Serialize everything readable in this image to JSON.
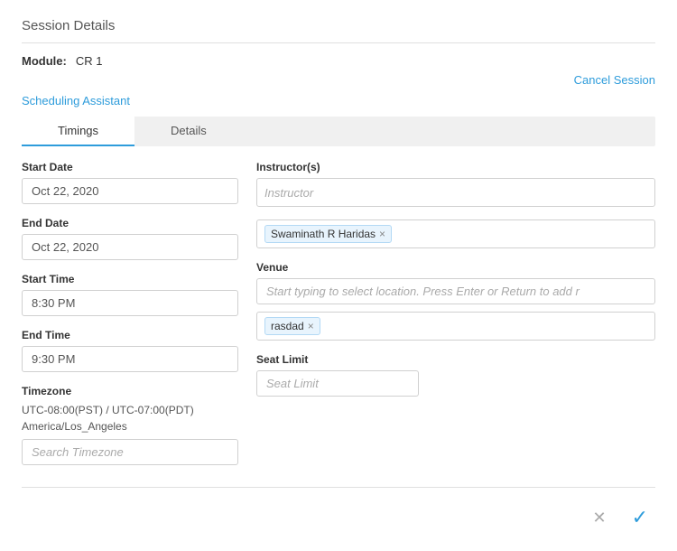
{
  "page": {
    "title": "Session Details",
    "module_label": "Module:",
    "module_value": "CR 1",
    "cancel_session": "Cancel Session",
    "scheduling_assistant": "Scheduling Assistant"
  },
  "tabs": [
    {
      "label": "Timings",
      "active": true
    },
    {
      "label": "Details",
      "active": false
    }
  ],
  "left_col": {
    "start_date_label": "Start Date",
    "start_date_value": "Oct 22, 2020",
    "end_date_label": "End Date",
    "end_date_value": "Oct 22, 2020",
    "start_time_label": "Start Time",
    "start_time_value": "8:30 PM",
    "end_time_label": "End Time",
    "end_time_value": "9:30 PM",
    "timezone_label": "Timezone",
    "timezone_text": "UTC-08:00(PST) / UTC-07:00(PDT) America/Los_Angeles",
    "timezone_placeholder": "Search Timezone"
  },
  "right_col": {
    "instructors_label": "Instructor(s)",
    "instructor_placeholder": "Instructor",
    "instructor_tag": "Swaminath R Haridas",
    "venue_label": "Venue",
    "venue_placeholder": "Start typing to select location. Press Enter or Return to add r",
    "venue_tag": "rasdad",
    "seat_limit_label": "Seat Limit",
    "seat_limit_placeholder": "Seat Limit"
  },
  "footer": {
    "cancel_icon": "✕",
    "confirm_icon": "✓"
  },
  "colors": {
    "link": "#2e9cdb",
    "border": "#d0d0d0",
    "bg_tab": "#f0f0f0"
  }
}
